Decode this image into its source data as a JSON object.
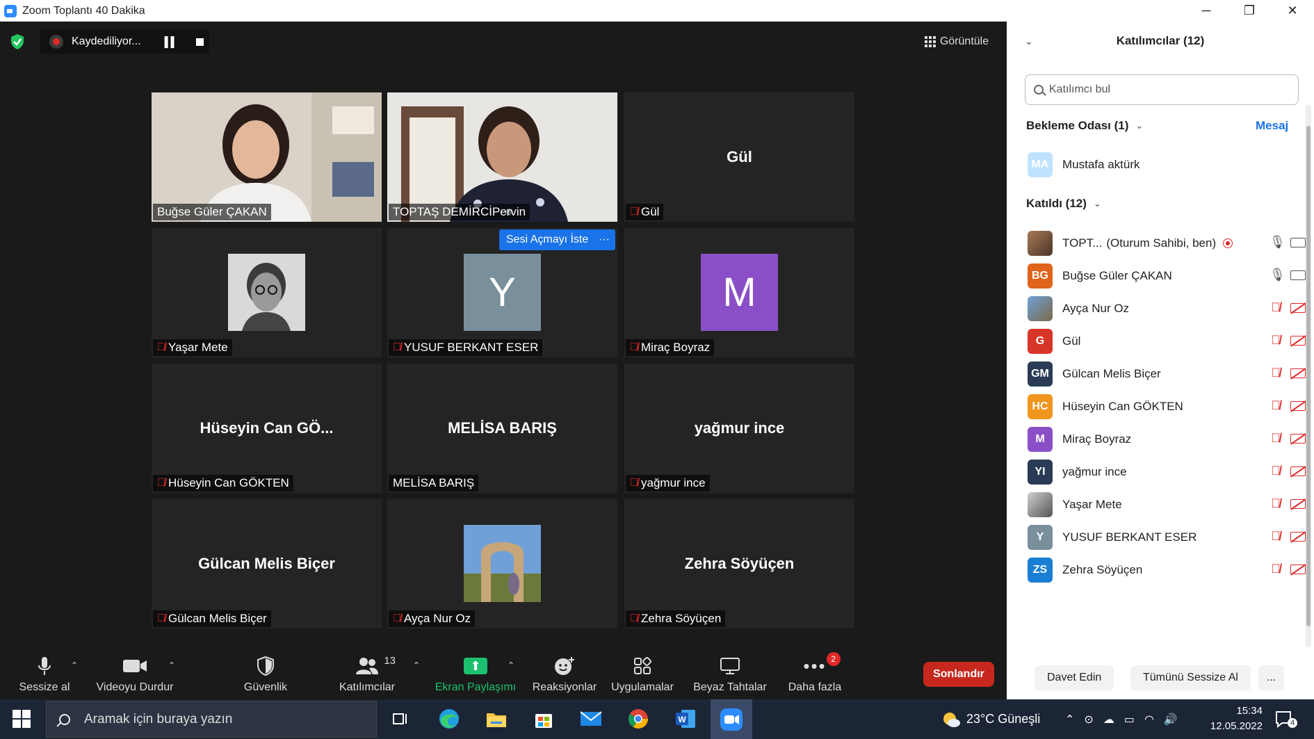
{
  "window": {
    "title": "Zoom Toplantı 40 Dakika",
    "controls": [
      "─",
      "❐",
      "✕"
    ]
  },
  "recording": {
    "label": "Kaydediliyor..."
  },
  "view_button": "Görüntüle",
  "tiles": [
    {
      "name": "Buğse Güler ÇAKAN",
      "big": "",
      "muted": false,
      "type": "video"
    },
    {
      "name": "TOPTAŞ DEMİRCİPervin",
      "big": "",
      "muted": false,
      "type": "video",
      "active": true
    },
    {
      "name": "Gül",
      "big": "Gül",
      "muted": true,
      "type": "name"
    },
    {
      "name": "Yaşar Mete",
      "big": "",
      "muted": true,
      "type": "photo"
    },
    {
      "name": "YUSUF BERKANT ESER",
      "big": "",
      "muted": true,
      "type": "avatar",
      "letter": "Y",
      "color": "#7a8f9c"
    },
    {
      "name": "Miraç Boyraz",
      "big": "",
      "muted": true,
      "type": "avatar",
      "letter": "M",
      "color": "#8a4fc7"
    },
    {
      "name": "Hüseyin Can GÖKTEN",
      "big": "Hüseyin Can GÖ...",
      "muted": true,
      "type": "name"
    },
    {
      "name": "MELİSA BARIŞ",
      "big": "MELİSA BARIŞ",
      "muted": false,
      "type": "name"
    },
    {
      "name": "yağmur ince",
      "big": "yağmur ince",
      "muted": true,
      "type": "name"
    },
    {
      "name": "Gülcan Melis Biçer",
      "big": "Gülcan Melis Biçer",
      "muted": true,
      "type": "name"
    },
    {
      "name": "Ayça Nur Oz",
      "big": "",
      "muted": true,
      "type": "photo"
    },
    {
      "name": "Zehra Söyüçen",
      "big": "Zehra Söyüçen",
      "muted": true,
      "type": "name"
    }
  ],
  "tile_actions": {
    "unmute_request": "Sesi Açmayı İste",
    "more": "···"
  },
  "toolbar": {
    "mute": "Sessize al",
    "video": "Videoyu Durdur",
    "security": "Güvenlik",
    "participants": "Katılımcılar",
    "participants_count": "13",
    "share": "Ekran Paylaşımı",
    "reactions": "Reaksiyonlar",
    "apps": "Uygulamalar",
    "whiteboard": "Beyaz Tahtalar",
    "more": "Daha fazla",
    "more_badge": "2",
    "end": "Sonlandır"
  },
  "panel": {
    "title": "Katılımcılar (12)",
    "search_placeholder": "Katılımcı bul",
    "waiting_header": "Bekleme Odası (1)",
    "message_link": "Mesaj",
    "waiting": [
      {
        "initials": "MA",
        "name": "Mustafa aktürk",
        "color": "#bfe3ff"
      }
    ],
    "joined_header": "Katıldı (12)",
    "joined": [
      {
        "initials": "",
        "name": "TOPT...",
        "sub": "(Oturum Sahibi, ben)",
        "color": "#8a5a3a",
        "mic": "on",
        "cam": "on",
        "rec": true,
        "photo": true
      },
      {
        "initials": "BG",
        "name": "Buğse Güler ÇAKAN",
        "sub": "",
        "color": "#e0641c",
        "mic": "on",
        "cam": "on"
      },
      {
        "initials": "",
        "name": "Ayça Nur Oz",
        "sub": "",
        "color": "#6b7d8a",
        "mic": "off",
        "cam": "off",
        "photo": true
      },
      {
        "initials": "G",
        "name": "Gül",
        "sub": "",
        "color": "#d9362a",
        "mic": "off",
        "cam": "off"
      },
      {
        "initials": "GM",
        "name": "Gülcan Melis Biçer",
        "sub": "",
        "color": "#2b3b55",
        "mic": "off",
        "cam": "off"
      },
      {
        "initials": "HC",
        "name": "Hüseyin Can GÖKTEN",
        "sub": "",
        "color": "#f0961e",
        "mic": "off",
        "cam": "off"
      },
      {
        "initials": "M",
        "name": "Miraç Boyraz",
        "sub": "",
        "color": "#8a4fc7",
        "mic": "off",
        "cam": "off"
      },
      {
        "initials": "YI",
        "name": "yağmur ince",
        "sub": "",
        "color": "#2b3b55",
        "mic": "off",
        "cam": "off"
      },
      {
        "initials": "",
        "name": "Yaşar Mete",
        "sub": "",
        "color": "#8a8a8a",
        "mic": "off",
        "cam": "off",
        "photo": true
      },
      {
        "initials": "Y",
        "name": "YUSUF BERKANT ESER",
        "sub": "",
        "color": "#7a8f9c",
        "mic": "off",
        "cam": "off"
      },
      {
        "initials": "ZS",
        "name": "Zehra Söyüçen",
        "sub": "",
        "color": "#1a7fd4",
        "mic": "off",
        "cam": "off"
      }
    ],
    "invite": "Davet Edin",
    "mute_all": "Tümünü Sessize Al",
    "more": "..."
  },
  "taskbar": {
    "search_text": "Aramak için buraya yazın",
    "weather": "23°C  Güneşli",
    "time": "15:34",
    "date": "12.05.2022",
    "notif_count": "4"
  }
}
